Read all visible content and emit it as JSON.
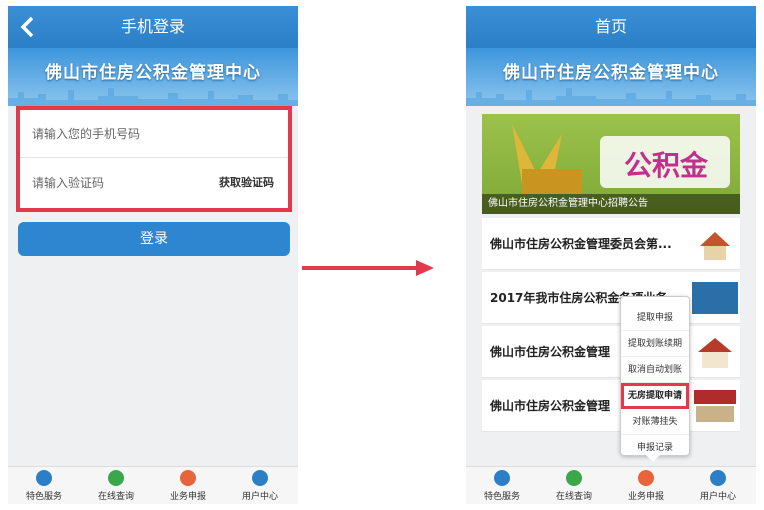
{
  "left": {
    "title": "手机登录",
    "banner_text": "佛山市住房公积金管理中心",
    "phone_placeholder": "请输入您的手机号码",
    "code_placeholder": "请输入验证码",
    "get_code_label": "获取验证码",
    "login_label": "登录"
  },
  "right": {
    "title": "首页",
    "banner_text": "佛山市住房公积金管理中心",
    "feature_caption": "佛山市住房公积金管理中心招聘公告",
    "feature_logo_text": "公积金",
    "news": [
      {
        "title": "佛山市住房公积金管理委员会第..."
      },
      {
        "title": "2017年我市住房公积金各项业务"
      },
      {
        "title": "佛山市住房公积金管理"
      },
      {
        "title": "佛山市住房公积金管理"
      }
    ],
    "popup_items": [
      {
        "label": "提取申报",
        "highlighted": false
      },
      {
        "label": "提取划账续期",
        "highlighted": false
      },
      {
        "label": "取消自动划账",
        "highlighted": false
      },
      {
        "label": "无房提取申请",
        "highlighted": true
      },
      {
        "label": "对账薄挂失",
        "highlighted": false
      },
      {
        "label": "申报记录",
        "highlighted": false
      }
    ]
  },
  "tabs": [
    {
      "label": "特色服务",
      "icon": "special-service-icon",
      "color": "#2b7fc6"
    },
    {
      "label": "在线查询",
      "icon": "search-icon",
      "color": "#3aa84a"
    },
    {
      "label": "业务申报",
      "icon": "report-icon",
      "color": "#e8643a"
    },
    {
      "label": "用户中心",
      "icon": "user-icon",
      "color": "#2b7fc6"
    }
  ],
  "colors": {
    "accent": "#2b7fc6",
    "highlight": "#e23a4c"
  }
}
